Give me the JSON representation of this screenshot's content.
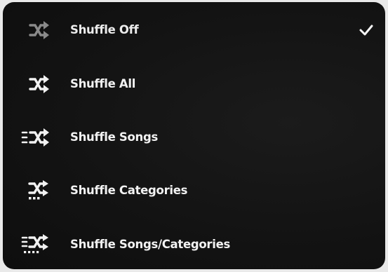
{
  "menu": {
    "items": [
      {
        "label": "Shuffle Off",
        "icon": "shuffle-icon",
        "selected": true,
        "dimmed": true
      },
      {
        "label": "Shuffle All",
        "icon": "shuffle-icon",
        "selected": false,
        "dimmed": false
      },
      {
        "label": "Shuffle Songs",
        "icon": "shuffle-songs-icon",
        "selected": false,
        "dimmed": false
      },
      {
        "label": "Shuffle Categories",
        "icon": "shuffle-categories-icon",
        "selected": false,
        "dimmed": false
      },
      {
        "label": "Shuffle Songs/Categories",
        "icon": "shuffle-songs-categories-icon",
        "selected": false,
        "dimmed": false
      }
    ],
    "selected_indicator": "checkmark-icon"
  }
}
